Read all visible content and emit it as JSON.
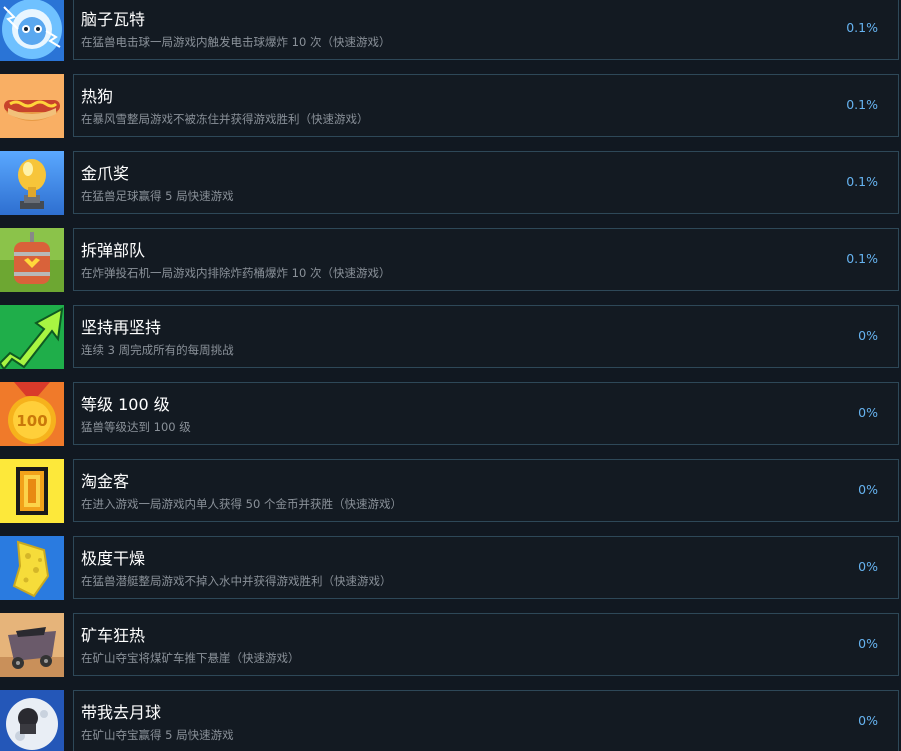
{
  "achievements": [
    {
      "icon": "electric-ball-icon",
      "title": "脑子瓦特",
      "desc": "在猛兽电击球一局游戏内触发电击球爆炸 10 次（快速游戏）",
      "percent": "0.1%"
    },
    {
      "icon": "hotdog-icon",
      "title": "热狗",
      "desc": "在暴风雪整局游戏不被冻住并获得游戏胜利（快速游戏）",
      "percent": "0.1%"
    },
    {
      "icon": "golden-claw-trophy-icon",
      "title": "金爪奖",
      "desc": "在猛兽足球赢得 5 局快速游戏",
      "percent": "0.1%"
    },
    {
      "icon": "bomb-barrel-icon",
      "title": "拆弹部队",
      "desc": "在炸弹投石机一局游戏内排除炸药桶爆炸 10 次（快速游戏）",
      "percent": "0.1%"
    },
    {
      "icon": "rising-arrow-icon",
      "title": "坚持再坚持",
      "desc": "连续 3 周完成所有的每周挑战",
      "percent": "0%"
    },
    {
      "icon": "level-100-medal-icon",
      "title": "等级 100 级",
      "desc": "猛兽等级达到 100 级",
      "percent": "0%"
    },
    {
      "icon": "gold-coin-icon",
      "title": "淘金客",
      "desc": "在进入游戏一局游戏内单人获得 50 个金币并获胜（快速游戏）",
      "percent": "0%"
    },
    {
      "icon": "sponge-icon",
      "title": "极度干燥",
      "desc": "在猛兽潜艇整局游戏不掉入水中并获得游戏胜利（快速游戏）",
      "percent": "0%"
    },
    {
      "icon": "mine-cart-icon",
      "title": "矿车狂热",
      "desc": "在矿山夺宝将煤矿车推下悬崖（快速游戏）",
      "percent": "0%"
    },
    {
      "icon": "moon-icon",
      "title": "带我去月球",
      "desc": "在矿山夺宝赢得 5 局快速游戏",
      "percent": "0%"
    }
  ]
}
